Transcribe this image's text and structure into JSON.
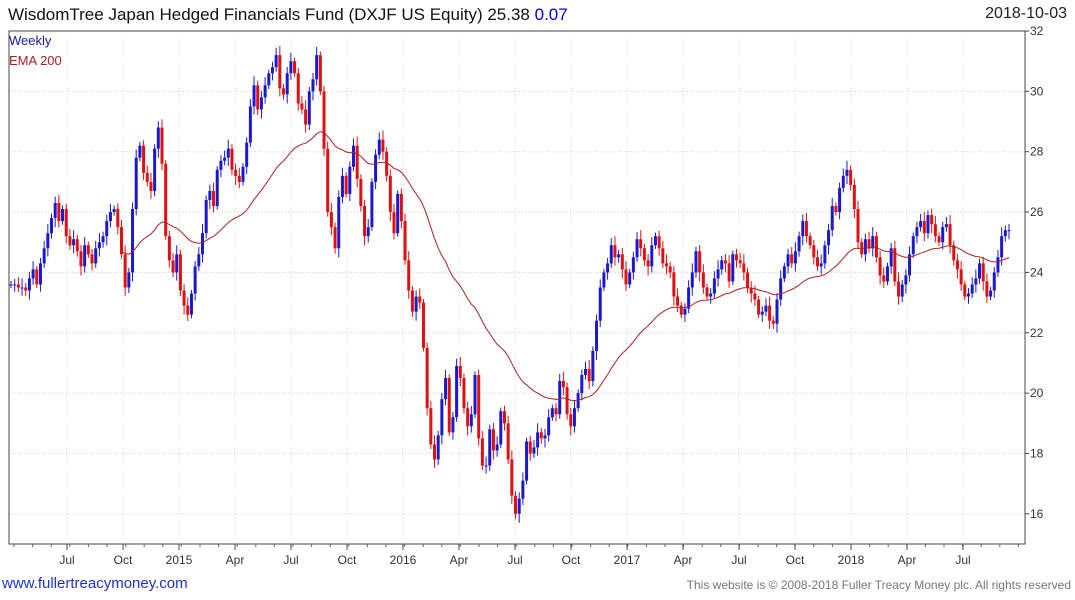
{
  "header": {
    "title": "WisdomTree Japan Hedged Financials Fund (DXJF US Equity) 25.38",
    "change": "0.07",
    "date": "2018-10-03"
  },
  "legend": {
    "series1": "Weekly",
    "series2": "EMA 200"
  },
  "footer": {
    "site": "www.fullertreacymoney.com",
    "copyright": "This website is © 2008-2018 Fuller Treacy Money plc. All rights reserved"
  },
  "colors": {
    "up": "#1a1acc",
    "down": "#dd1111",
    "ema": "#aa2222",
    "grid": "#cfcfcf",
    "legend1": "#1a1aaa",
    "legend2": "#aa2222"
  },
  "chart_data": {
    "type": "candlestick",
    "y_axis": {
      "min": 15,
      "max": 32,
      "ticks": [
        16,
        18,
        20,
        22,
        24,
        26,
        28,
        30,
        32
      ],
      "position": "right"
    },
    "x_ticks": [
      "Jul",
      "Oct",
      "2015",
      "Apr",
      "Jul",
      "Oct",
      "2016",
      "Apr",
      "Jul",
      "Oct",
      "2017",
      "Apr",
      "Jul",
      "Oct",
      "2018",
      "Apr",
      "Jul"
    ],
    "grid": true,
    "weekly_close": [
      23.6,
      23.6,
      23.5,
      23.5,
      23.4,
      23.8,
      24.1,
      23.6,
      24.3,
      24.8,
      25.3,
      25.8,
      26.3,
      25.7,
      26.1,
      25.2,
      24.9,
      25.1,
      24.7,
      24.2,
      24.9,
      24.6,
      24.3,
      24.8,
      25.0,
      25.2,
      25.7,
      26.0,
      26.1,
      25.5,
      24.6,
      23.5,
      24.0,
      26.1,
      27.8,
      28.2,
      27.3,
      27.0,
      26.7,
      28.1,
      28.8,
      27.6,
      25.2,
      24.4,
      24.0,
      24.6,
      23.4,
      22.9,
      22.6,
      23.3,
      24.2,
      24.6,
      25.3,
      26.4,
      26.7,
      26.2,
      27.4,
      27.7,
      27.8,
      28.1,
      27.4,
      27.2,
      27.0,
      27.5,
      28.3,
      29.5,
      30.2,
      29.4,
      29.8,
      30.2,
      30.6,
      30.8,
      31.2,
      30.1,
      29.9,
      30.6,
      31.0,
      30.6,
      29.6,
      29.4,
      28.9,
      30.0,
      30.4,
      31.2,
      30.0,
      28.1,
      26.0,
      25.5,
      24.8,
      26.5,
      27.2,
      26.6,
      27.5,
      28.2,
      27.1,
      26.2,
      25.2,
      25.5,
      27.0,
      27.9,
      28.4,
      28.0,
      27.2,
      26.0,
      25.3,
      26.6,
      25.7,
      24.4,
      23.4,
      22.7,
      23.2,
      23.0,
      21.5,
      19.5,
      18.3,
      17.8,
      18.6,
      19.8,
      20.5,
      18.7,
      19.2,
      20.9,
      20.5,
      19.5,
      18.9,
      19.3,
      20.6,
      18.5,
      17.6,
      17.6,
      18.8,
      18.1,
      18.3,
      19.4,
      19.0,
      17.8,
      16.6,
      16.0,
      16.5,
      17.1,
      18.4,
      18.0,
      18.2,
      18.7,
      18.5,
      18.6,
      19.2,
      19.5,
      19.3,
      20.4,
      20.2,
      19.3,
      18.9,
      19.5,
      20.0,
      20.6,
      20.8,
      20.4,
      21.4,
      22.4,
      23.5,
      24.0,
      24.3,
      24.9,
      24.5,
      24.6,
      24.1,
      23.6,
      24.0,
      24.5,
      25.1,
      24.8,
      24.4,
      24.2,
      24.9,
      25.2,
      24.8,
      24.3,
      24.2,
      24.0,
      23.2,
      22.9,
      22.6,
      22.8,
      23.5,
      24.0,
      24.7,
      24.0,
      23.5,
      23.2,
      23.3,
      23.8,
      24.1,
      24.4,
      24.3,
      23.7,
      24.6,
      24.4,
      24.3,
      24.0,
      23.5,
      23.3,
      23.1,
      22.6,
      22.7,
      22.9,
      22.4,
      22.3,
      23.1,
      23.8,
      24.2,
      24.6,
      24.3,
      24.7,
      25.2,
      25.7,
      25.2,
      24.9,
      24.5,
      24.2,
      24.3,
      24.9,
      25.4,
      26.2,
      26.0,
      26.8,
      27.2,
      27.4,
      26.9,
      26.1,
      25.0,
      24.6,
      25.1,
      24.8,
      25.2,
      24.5,
      23.9,
      23.7,
      24.2,
      24.8,
      23.7,
      23.2,
      23.6,
      23.9,
      24.6,
      25.2,
      25.5,
      25.7,
      25.3,
      25.9,
      25.6,
      25.2,
      25.0,
      25.5,
      25.6,
      24.9,
      24.4,
      24.1,
      23.6,
      23.2,
      23.3,
      23.6,
      23.8,
      24.3,
      23.7,
      23.2,
      23.4,
      24.0,
      24.5,
      25.2,
      25.4,
      25.4
    ]
  }
}
